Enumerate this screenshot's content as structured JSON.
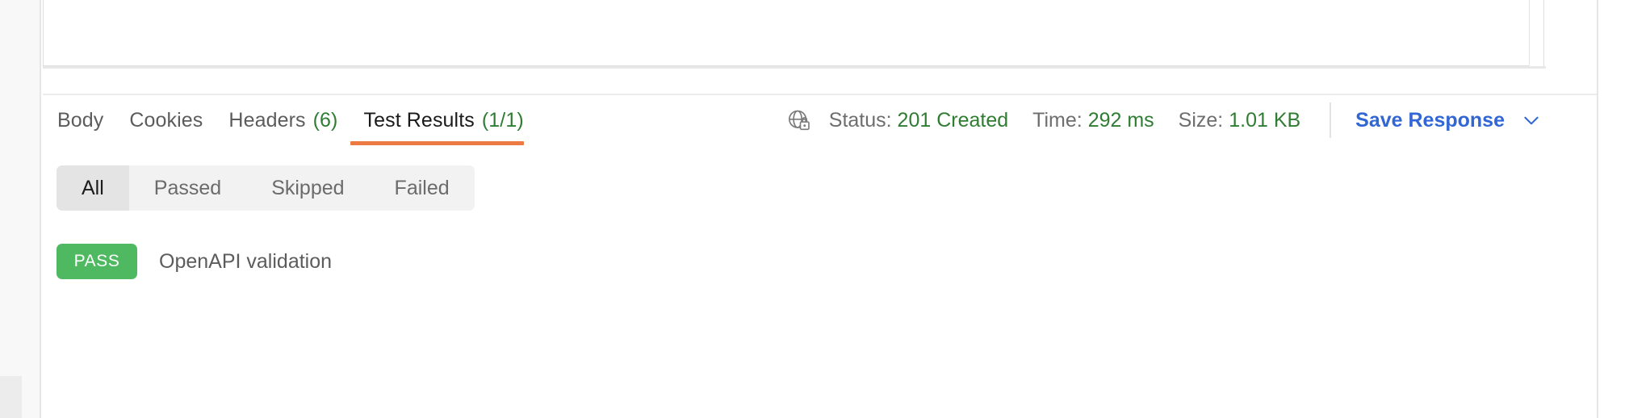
{
  "response_body_panel": {
    "content": ""
  },
  "response_tabs": {
    "items": [
      {
        "label": "Body",
        "count": "",
        "active": false
      },
      {
        "label": "Cookies",
        "count": "",
        "active": false
      },
      {
        "label": "Headers",
        "count": "(6)",
        "active": false
      },
      {
        "label": "Test Results",
        "count": "(1/1)",
        "active": true
      }
    ],
    "active_underline_color": "#ec7a42"
  },
  "response_meta": {
    "secure_icon": "globe-lock-icon",
    "status_label": "Status:",
    "status_value": "201 Created",
    "time_label": "Time:",
    "time_value": "292 ms",
    "size_label": "Size:",
    "size_value": "1.01 KB",
    "value_color": "#2f7d32",
    "save_response_label": "Save Response",
    "save_response_color": "#3166d4",
    "save_response_chevron": "chevron-down-icon"
  },
  "test_filters": {
    "items": [
      {
        "label": "All",
        "active": true
      },
      {
        "label": "Passed",
        "active": false
      },
      {
        "label": "Skipped",
        "active": false
      },
      {
        "label": "Failed",
        "active": false
      }
    ]
  },
  "test_results": {
    "rows": [
      {
        "status": "PASS",
        "status_kind": "pass",
        "name": "OpenAPI validation"
      }
    ],
    "pass_color": "#4fb961"
  }
}
